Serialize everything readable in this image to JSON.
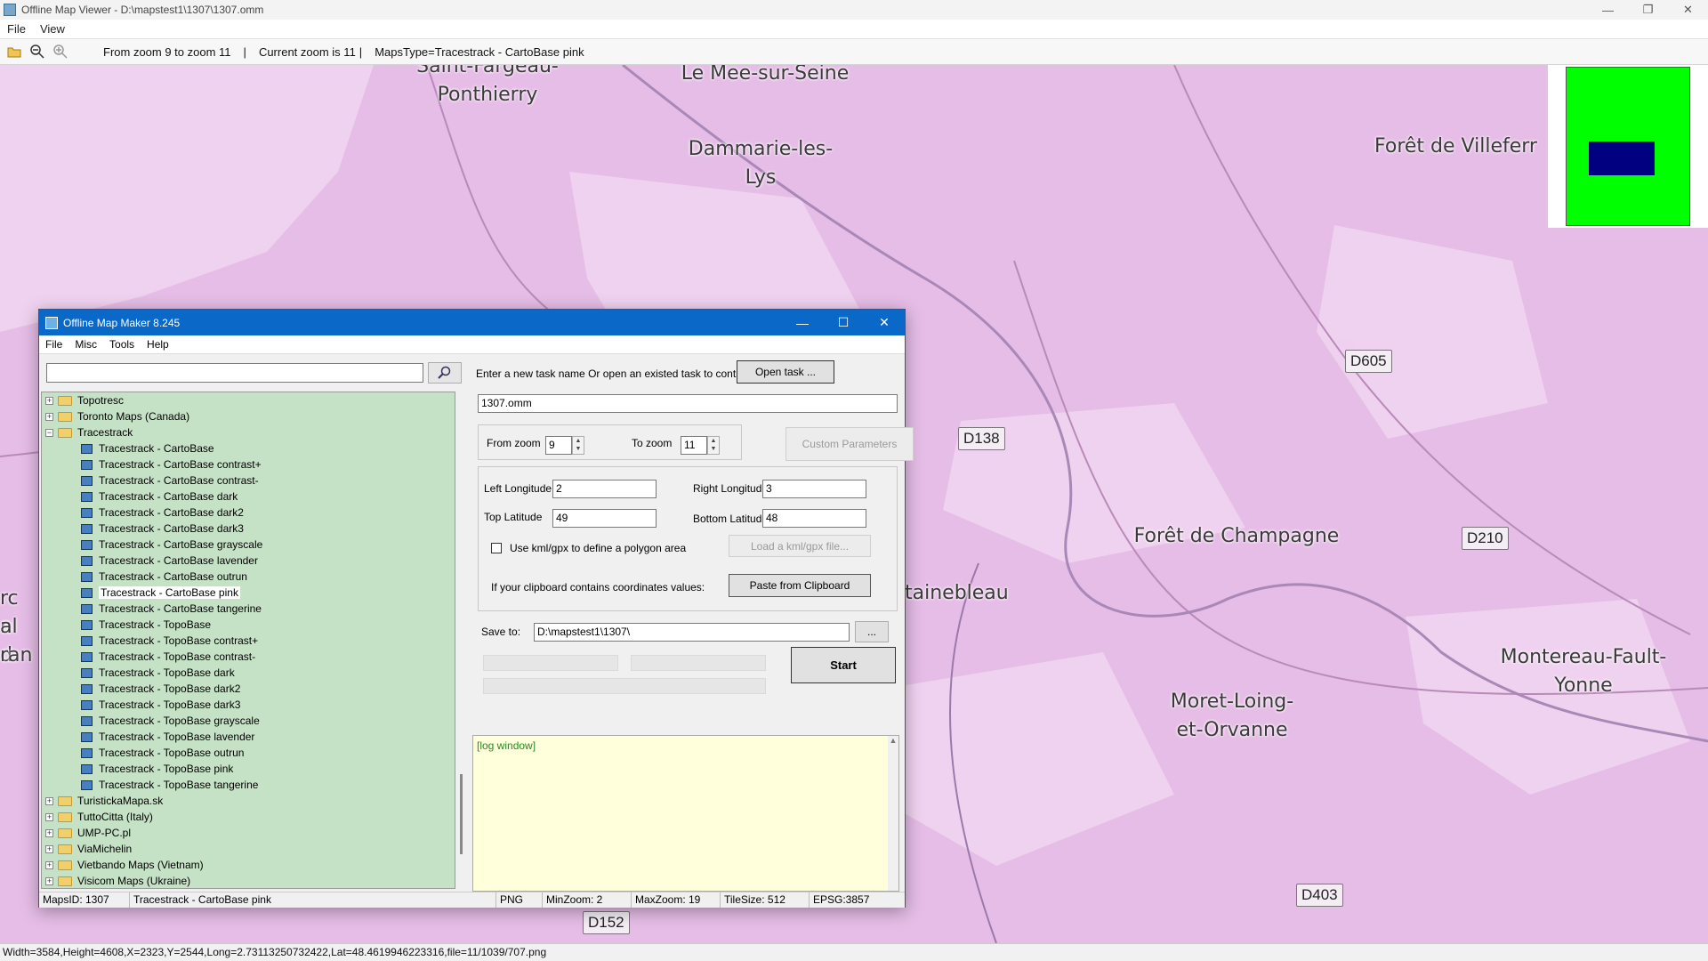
{
  "window": {
    "title": "Offline Map Viewer - D:\\mapstest1\\1307\\1307.omm",
    "controls": {
      "minimize": "—",
      "restore": "❐",
      "close": "✕"
    }
  },
  "menu": [
    "File",
    "View"
  ],
  "toolbar": {
    "icons": [
      "open-folder-icon",
      "zoom-out-icon",
      "zoom-in-icon"
    ],
    "zoom_range": "From zoom 9 to zoom 11",
    "current_zoom": "Current zoom is 11",
    "maps_type": "MapsType=Tracestrack - CartoBase pink",
    "sep": "|"
  },
  "map": {
    "background_color": "#e5bde6",
    "places": [
      "Saint-Fargeau-\nPonthierry",
      "Le Mee-sur-Seine",
      "Dammarie-les-\nLys",
      "Forêt de Villeferr",
      "Forêt de Champagne",
      "tainebleau",
      "Moret-Loing-\net-Orvanne",
      "Montereau-Fault-\nYonne",
      "rc n",
      "al d",
      "ran"
    ],
    "roads": [
      "D605",
      "D138",
      "D210",
      "D403",
      "D152"
    ]
  },
  "minimap": {
    "frame_color": "#00ff00",
    "view_color": "#000080"
  },
  "status": "Width=3584,Height=4608,X=2323,Y=2544,Long=2.73113250732422,Lat=48.4619946223316,file=11/1039/707.png",
  "dialog": {
    "title": "Offline Map Maker 8.245",
    "controls": {
      "minimize": "—",
      "maximize": "☐",
      "close": "✕"
    },
    "menu": [
      "File",
      "Misc",
      "Tools",
      "Help"
    ],
    "search_value": "",
    "tree": [
      {
        "label": "Topotresc",
        "type": "folder",
        "expander": "+"
      },
      {
        "label": "Toronto Maps (Canada)",
        "type": "folder",
        "expander": "+"
      },
      {
        "label": "Tracestrack",
        "type": "folder",
        "expander": "−"
      },
      {
        "label": "Tracestrack - CartoBase",
        "type": "map"
      },
      {
        "label": "Tracestrack - CartoBase contrast+",
        "type": "map"
      },
      {
        "label": "Tracestrack - CartoBase contrast-",
        "type": "map"
      },
      {
        "label": "Tracestrack - CartoBase dark",
        "type": "map"
      },
      {
        "label": "Tracestrack - CartoBase dark2",
        "type": "map"
      },
      {
        "label": "Tracestrack - CartoBase dark3",
        "type": "map"
      },
      {
        "label": "Tracestrack - CartoBase grayscale",
        "type": "map"
      },
      {
        "label": "Tracestrack - CartoBase lavender",
        "type": "map"
      },
      {
        "label": "Tracestrack - CartoBase outrun",
        "type": "map"
      },
      {
        "label": "Tracestrack - CartoBase pink",
        "type": "map",
        "selected": true
      },
      {
        "label": "Tracestrack - CartoBase tangerine",
        "type": "map"
      },
      {
        "label": "Tracestrack - TopoBase",
        "type": "map"
      },
      {
        "label": "Tracestrack - TopoBase contrast+",
        "type": "map"
      },
      {
        "label": "Tracestrack - TopoBase contrast-",
        "type": "map"
      },
      {
        "label": "Tracestrack - TopoBase dark",
        "type": "map"
      },
      {
        "label": "Tracestrack - TopoBase dark2",
        "type": "map"
      },
      {
        "label": "Tracestrack - TopoBase dark3",
        "type": "map"
      },
      {
        "label": "Tracestrack - TopoBase grayscale",
        "type": "map"
      },
      {
        "label": "Tracestrack - TopoBase lavender",
        "type": "map"
      },
      {
        "label": "Tracestrack - TopoBase outrun",
        "type": "map"
      },
      {
        "label": "Tracestrack - TopoBase pink",
        "type": "map"
      },
      {
        "label": "Tracestrack - TopoBase tangerine",
        "type": "map"
      },
      {
        "label": "TuristickaMapa.sk",
        "type": "folder",
        "expander": "+"
      },
      {
        "label": "TuttoCitta (Italy)",
        "type": "folder",
        "expander": "+"
      },
      {
        "label": "UMP-PC.pl",
        "type": "folder",
        "expander": "+"
      },
      {
        "label": "ViaMichelin",
        "type": "folder",
        "expander": "+"
      },
      {
        "label": "Vietbando Maps (Vietnam)",
        "type": "folder",
        "expander": "+"
      },
      {
        "label": "Visicom Maps (Ukraine)",
        "type": "folder",
        "expander": "+"
      }
    ],
    "task_prompt": "Enter a new task name Or open an existed task to continue:",
    "open_task": "Open task ...",
    "task_name": "1307.omm",
    "from_zoom_label": "From zoom",
    "from_zoom": "9",
    "to_zoom_label": "To zoom",
    "to_zoom": "11",
    "custom_params": "Custom Parameters",
    "left_lon_label": "Left Longitude",
    "left_lon": "2",
    "right_lon_label": "Right Longitude",
    "right_lon": "3",
    "top_lat_label": "Top Latitude",
    "top_lat": "49",
    "bottom_lat_label": "Bottom Latitude",
    "bottom_lat": "48",
    "kml_label": "Use kml/gpx to define a polygon area",
    "kml_button": "Load a kml/gpx file...",
    "clipboard_label": "If your clipboard contains coordinates values:",
    "clipboard_button": "Paste from Clipboard",
    "save_label": "Save to:",
    "save_path": "D:\\mapstest1\\1307\\",
    "browse": "...",
    "start": "Start",
    "log": "[log window]",
    "status": {
      "maps_id": "MapsID: 1307",
      "map_name": "Tracestrack - CartoBase pink",
      "format": "PNG",
      "min_zoom": "MinZoom: 2",
      "max_zoom": "MaxZoom: 19",
      "tile_size": "TileSize: 512",
      "epsg": "EPSG:3857"
    }
  }
}
